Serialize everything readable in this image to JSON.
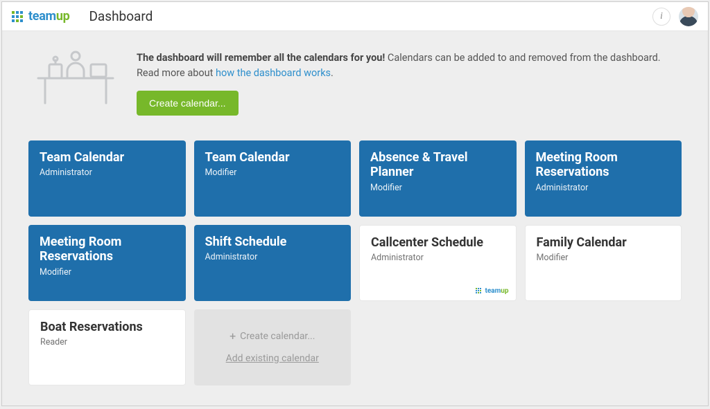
{
  "header": {
    "logo_team": "team",
    "logo_up": "up",
    "title": "Dashboard"
  },
  "intro": {
    "bold": "The dashboard will remember all the calendars for you!",
    "rest": " Calendars can be added to and removed from the dashboard. Read more about ",
    "link": "how the dashboard works",
    "period": ".",
    "create_label": "Create calendar..."
  },
  "cards": [
    {
      "title": "Team Calendar",
      "role": "Administrator",
      "variant": "blue"
    },
    {
      "title": "Team Calendar",
      "role": "Modifier",
      "variant": "blue"
    },
    {
      "title": "Absence & Travel Planner",
      "role": "Modifier",
      "variant": "blue"
    },
    {
      "title": "Meeting Room Reservations",
      "role": "Administrator",
      "variant": "blue"
    },
    {
      "title": "Meeting Room Reservations",
      "role": "Modifier",
      "variant": "blue"
    },
    {
      "title": "Shift Schedule",
      "role": "Administrator",
      "variant": "blue"
    },
    {
      "title": "Callcenter Schedule",
      "role": "Administrator",
      "variant": "white",
      "badge": true
    },
    {
      "title": "Family Calendar",
      "role": "Modifier",
      "variant": "white"
    },
    {
      "title": "Boat Reservations",
      "role": "Reader",
      "variant": "white"
    }
  ],
  "create_card": {
    "create_label": "Create calendar...",
    "add_existing_label": "Add existing calendar"
  },
  "badge": {
    "team": "team",
    "up": "up"
  }
}
